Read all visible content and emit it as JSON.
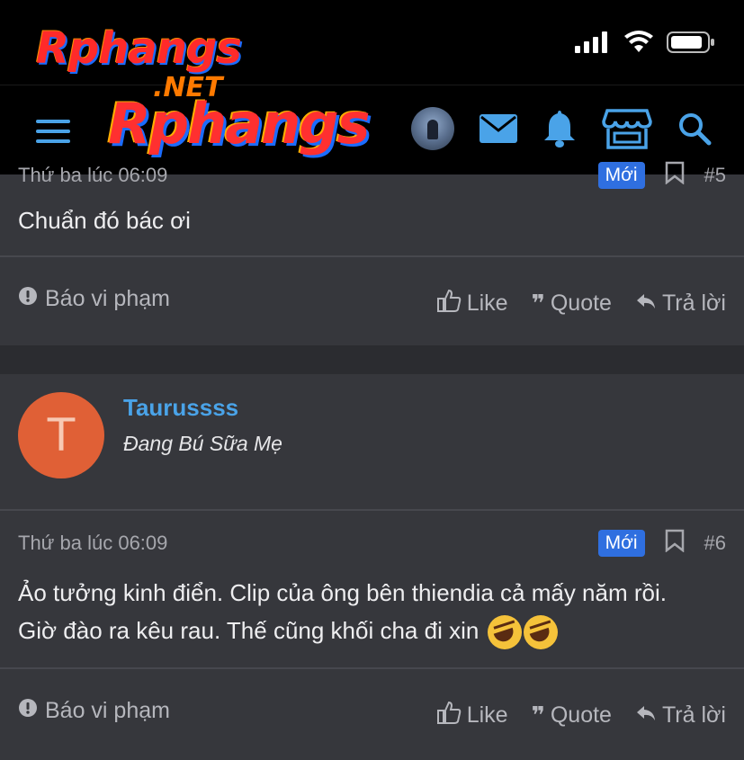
{
  "watermark": {
    "brand": "Rphangs",
    "domain": ".NET"
  },
  "header": {
    "logo": "Rphangs"
  },
  "colors": {
    "accent": "#4aa3e8",
    "badge": "#2f6fe0",
    "avatar_bg": "#e06036",
    "card_bg": "#36373c"
  },
  "post1": {
    "timestamp": "Thứ ba lúc 06:09",
    "badge": "Mới",
    "number": "#5",
    "body": "Chuẩn đó bác ơi",
    "report": "Báo vi phạm",
    "like": "Like",
    "quote": "Quote",
    "reply": "Trả lời"
  },
  "post2": {
    "avatar_letter": "T",
    "username": "Taurussss",
    "user_title": "Đang Bú Sữa Mẹ",
    "timestamp": "Thứ ba lúc 06:09",
    "badge": "Mới",
    "number": "#6",
    "body_line1": "Ảo tưởng kinh điển. Clip của ông bên thiendia cả mấy năm rồi.",
    "body_line2": "Giờ đào ra kêu rau. Thế cũng khối cha đi xin",
    "emoji": "rolling-on-floor-laughing",
    "report": "Báo vi phạm",
    "like": "Like",
    "quote": "Quote",
    "reply": "Trả lời"
  }
}
